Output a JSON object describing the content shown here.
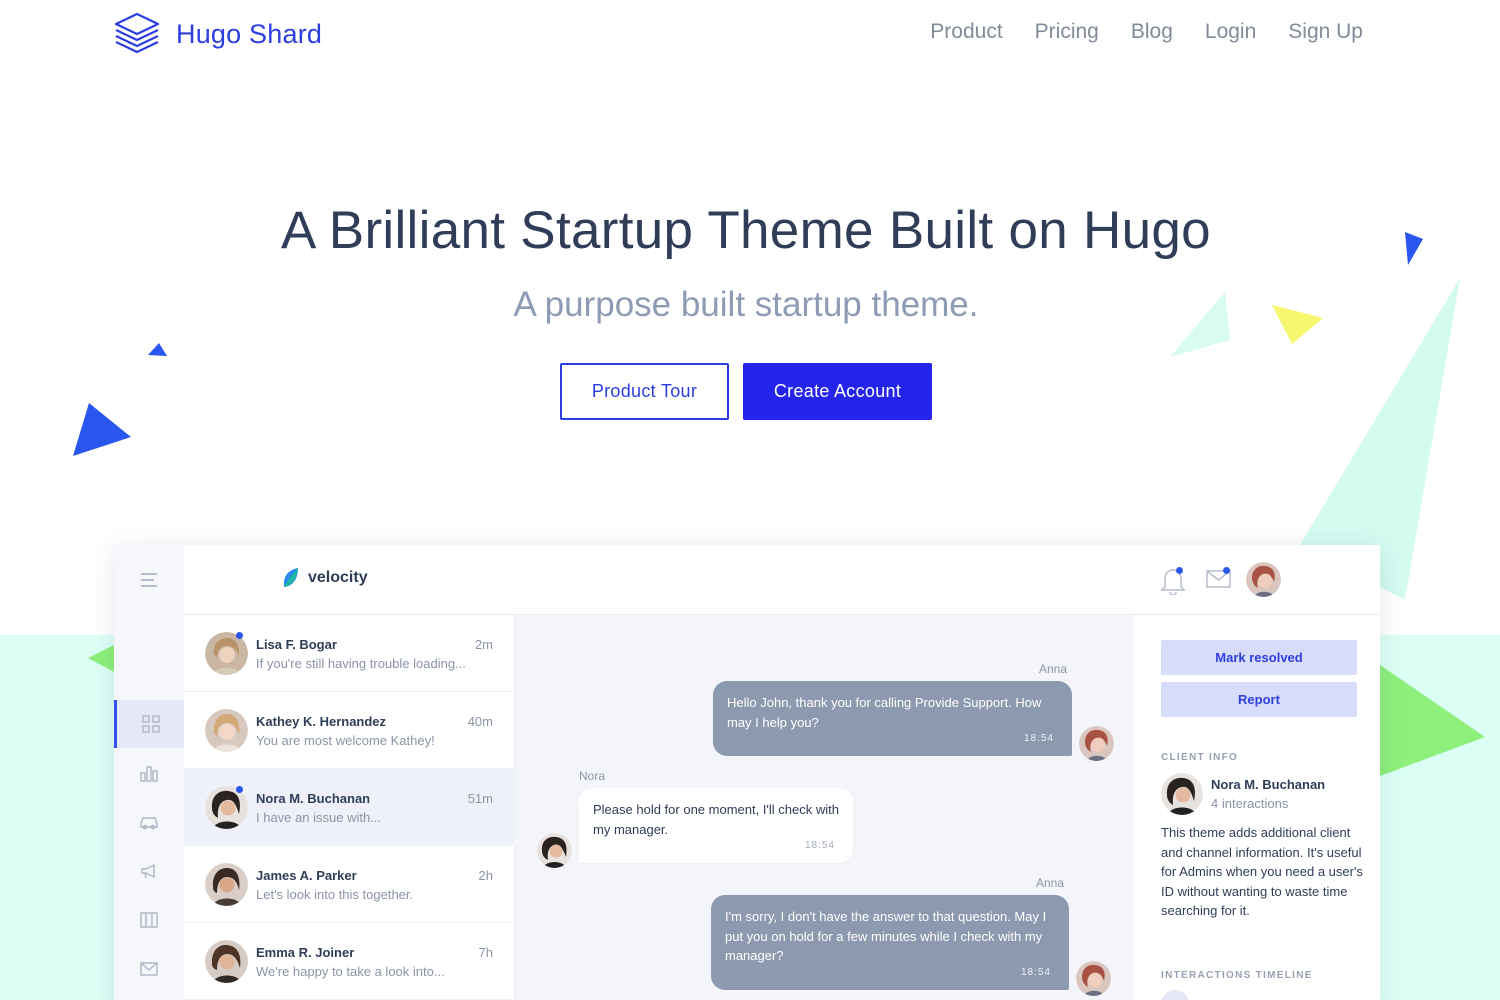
{
  "header": {
    "brand": "Hugo Shard",
    "nav": [
      "Product",
      "Pricing",
      "Blog",
      "Login",
      "Sign Up"
    ]
  },
  "hero": {
    "title": "A Brilliant Startup Theme Built on Hugo",
    "subtitle": "A purpose built startup theme.",
    "tour_label": "Product Tour",
    "create_label": "Create Account"
  },
  "app": {
    "brand": "velocity",
    "conversations": [
      {
        "name": "Lisa F. Bogar",
        "preview": "If you're still having trouble loading...",
        "time": "2m",
        "unread": true
      },
      {
        "name": "Kathey K. Hernandez",
        "preview": "You are most welcome Kathey!",
        "time": "40m",
        "unread": false
      },
      {
        "name": "Nora M. Buchanan",
        "preview": "I have an issue with...",
        "time": "51m",
        "unread": true
      },
      {
        "name": "James A. Parker",
        "preview": "Let's look into this together.",
        "time": "2h",
        "unread": false
      },
      {
        "name": "Emma R. Joiner",
        "preview": "We're happy to take a look into...",
        "time": "7h",
        "unread": false
      }
    ],
    "messages": [
      {
        "sender": "Anna",
        "text": "Hello John, thank you for calling Provide Support. How may I help you?",
        "time": "18:54",
        "direction": "out"
      },
      {
        "sender": "Nora",
        "text": "Please hold for one moment, I'll check with my manager.",
        "time": "18:54",
        "direction": "in"
      },
      {
        "sender": "Anna",
        "text": "I'm sorry, I don't have the answer to that question. May I put you on hold for a few minutes while I check with my manager?",
        "time": "18:54",
        "direction": "out"
      }
    ],
    "side": {
      "mark_resolved": "Mark resolved",
      "report": "Report",
      "client_info_label": "CLIENT INFO",
      "client_name": "Nora M. Buchanan",
      "client_interactions": "4 interactions",
      "client_desc": "This theme adds additional client and channel information. It's useful for Admins when you need a user's ID without wanting to waste time searching for it.",
      "timeline_label": "INTERACTIONS TIMELINE"
    }
  },
  "colors": {
    "brand_blue": "#2d3ee0",
    "cta_blue": "#2424ec",
    "mint": "#dcfff5",
    "bubble_out": "#8c99ae"
  }
}
